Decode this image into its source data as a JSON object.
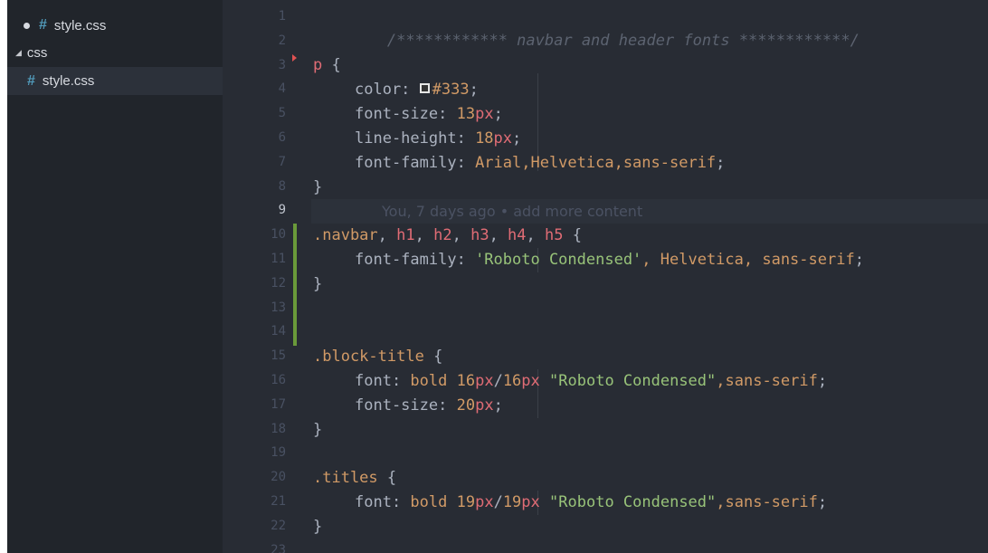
{
  "sidebar": {
    "open_file": {
      "name": "style.css"
    },
    "folder": {
      "name": "css"
    },
    "file": {
      "name": "style.css"
    },
    "file_icon_glyph": "#"
  },
  "editor": {
    "current_line": 9,
    "line_numbers": [
      "1",
      "2",
      "3",
      "4",
      "5",
      "6",
      "7",
      "8",
      "9",
      "10",
      "11",
      "12",
      "13",
      "14",
      "15",
      "16",
      "17",
      "18",
      "19",
      "20",
      "21",
      "22",
      "23"
    ],
    "lines": {
      "l1": {
        "comment": "/************ navbar and header fonts ************/"
      },
      "l3": {
        "selector": "p",
        "brace": " {"
      },
      "l4": {
        "prop": "color: ",
        "value": "#333",
        "semi": ";"
      },
      "l5": {
        "prop": "font-size: ",
        "value": "13",
        "unit": "px",
        "semi": ";"
      },
      "l6": {
        "prop": "line-height: ",
        "value": "18",
        "unit": "px",
        "semi": ";"
      },
      "l7": {
        "prop": "font-family: ",
        "value": "Arial,Helvetica,sans-serif",
        "semi": ";"
      },
      "l8": {
        "brace": "}"
      },
      "l9": {
        "blame": "You, 7 days ago • add more content"
      },
      "l10": {
        "cls": ".navbar",
        "sep1": ", ",
        "s1": "h1",
        "sep2": ", ",
        "s2": "h2",
        "sep3": ", ",
        "s3": "h3",
        "sep4": ", ",
        "s4": "h4",
        "sep5": ", ",
        "s5": "h5",
        "brace": " {"
      },
      "l11": {
        "prop": "font-family: ",
        "str": "'Roboto Condensed'",
        "rest": ", Helvetica, sans-serif",
        "semi": ";"
      },
      "l12": {
        "brace": "}"
      },
      "l15": {
        "cls": ".block-title",
        "brace": " {"
      },
      "l16": {
        "prop": "font: ",
        "v1": "bold 16",
        "u1": "px",
        "slash": "/",
        "v2": "16",
        "u2": "px",
        "sp": " ",
        "str": "\"Roboto Condensed\"",
        "rest": ",sans-serif",
        "semi": ";"
      },
      "l17": {
        "prop": "font-size: ",
        "value": "20",
        "unit": "px",
        "semi": ";"
      },
      "l18": {
        "brace": "}"
      },
      "l20": {
        "cls": ".titles",
        "brace": " {"
      },
      "l21": {
        "prop": "font: ",
        "v1": "bold 19",
        "u1": "px",
        "slash": "/",
        "v2": "19",
        "u2": "px",
        "sp": " ",
        "str": "\"Roboto Condensed\"",
        "rest": ",sans-serif",
        "semi": ";"
      },
      "l22": {
        "brace": "}"
      }
    }
  },
  "colors": {
    "editor_bg": "#282c34",
    "sidebar_bg": "#21252b",
    "git_added": "#6a9a3a",
    "selector": "#e06c75",
    "number": "#d19a66",
    "string": "#98c379",
    "comment": "#5c6370"
  }
}
